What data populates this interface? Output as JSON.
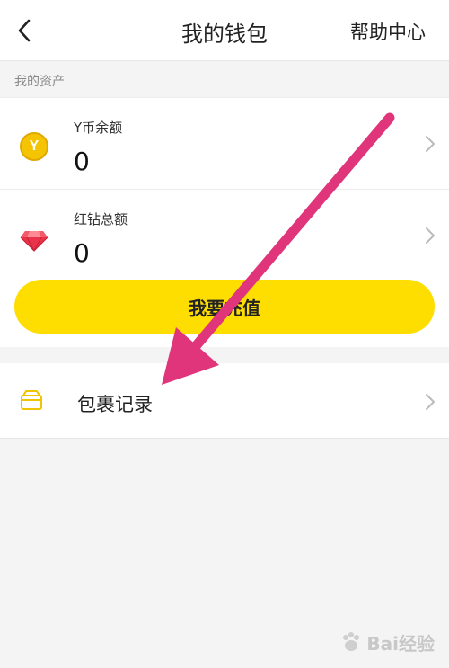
{
  "header": {
    "back_icon": "chevron-left-icon",
    "title": "我的钱包",
    "help_label": "帮助中心"
  },
  "assets_section": {
    "label": "我的资产"
  },
  "balances": [
    {
      "icon": "y-coin-icon",
      "coin_text": "Y",
      "label": "Y币余额",
      "value": "0"
    },
    {
      "icon": "red-diamond-icon",
      "label": "红钻总额",
      "value": "0"
    }
  ],
  "recharge_button": {
    "label": "我要充值"
  },
  "parcel": {
    "icon": "box-icon",
    "label": "包裹记录"
  },
  "watermark": {
    "text": "Bai经验"
  },
  "colors": {
    "accent_yellow": "#fedd00",
    "annotation_arrow": "#e0357a",
    "background": "#f4f4f4"
  }
}
